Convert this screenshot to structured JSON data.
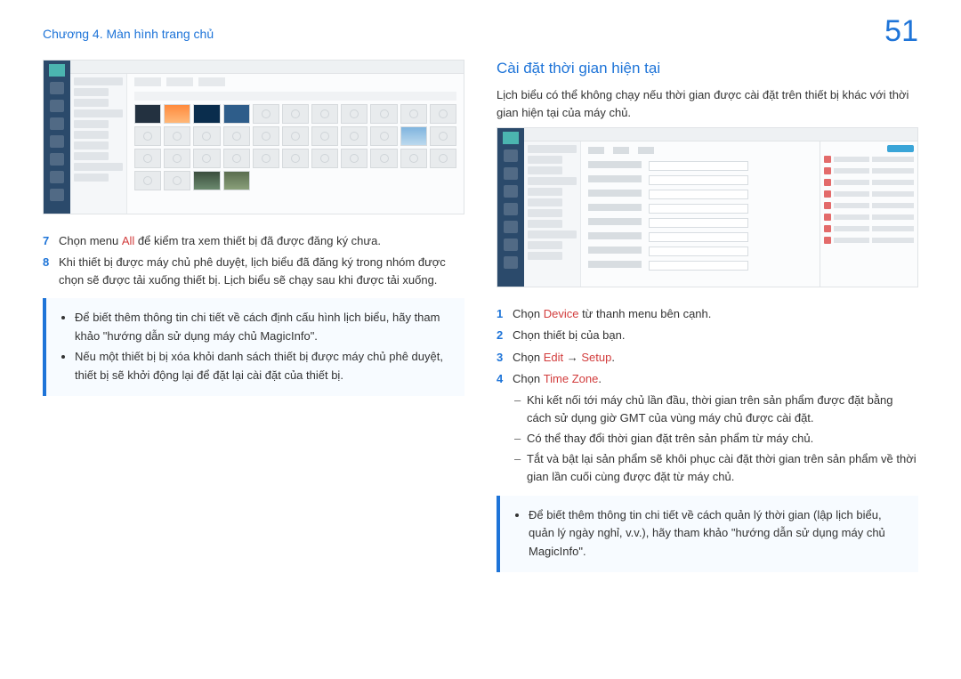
{
  "header": {
    "chapter": "Chương 4. Màn hình trang chủ",
    "page_number": "51"
  },
  "left": {
    "step7": {
      "num": "7",
      "pre": "Chọn menu ",
      "highlight": "All",
      "post": " để kiểm tra xem thiết bị đã được đăng ký chưa."
    },
    "step8": {
      "num": "8",
      "text": "Khi thiết bị được máy chủ phê duyệt, lịch biểu đã đăng ký trong nhóm được chọn sẽ được tải xuống thiết bị. Lịch biểu sẽ chạy sau khi được tải xuống."
    },
    "note": {
      "bullet1": "Để biết thêm thông tin chi tiết về cách định cấu hình lịch biểu, hãy tham khảo \"hướng dẫn sử dụng máy chủ MagicInfo\".",
      "bullet2": "Nếu một thiết bị bị xóa khỏi danh sách thiết bị được máy chủ phê duyệt, thiết bị sẽ khởi động lại để đặt lại cài đặt của thiết bị."
    }
  },
  "right": {
    "title": "Cài đặt thời gian hiện tại",
    "intro": "Lịch biểu có thể không chạy nếu thời gian được cài đặt trên thiết bị khác với thời gian hiện tại của máy chủ.",
    "step1": {
      "num": "1",
      "pre": "Chọn ",
      "hl": "Device",
      "post": " từ thanh menu bên cạnh."
    },
    "step2": {
      "num": "2",
      "text": "Chọn thiết bị của bạn."
    },
    "step3": {
      "num": "3",
      "pre": "Chọn ",
      "hl1": "Edit",
      "arrow": " → ",
      "hl2": "Setup",
      "post": "."
    },
    "step4": {
      "num": "4",
      "pre": "Chọn ",
      "hl": "Time Zone",
      "post": "."
    },
    "sub1": "Khi kết nối tới máy chủ lần đầu, thời gian trên sản phẩm được đặt bằng cách sử dụng giờ GMT của vùng máy chủ được cài đặt.",
    "sub2": "Có thể thay đổi thời gian đặt trên sản phẩm từ máy chủ.",
    "sub3": "Tắt và bật lại sản phẩm sẽ khôi phục cài đặt thời gian trên sản phẩm về thời gian lần cuối cùng được đặt từ máy chủ.",
    "note": "Để biết thêm thông tin chi tiết về cách quản lý thời gian (lập lịch biểu, quản lý ngày nghỉ, v.v.), hãy tham khảo \"hướng dẫn sử dụng máy chủ MagicInfo\"."
  }
}
